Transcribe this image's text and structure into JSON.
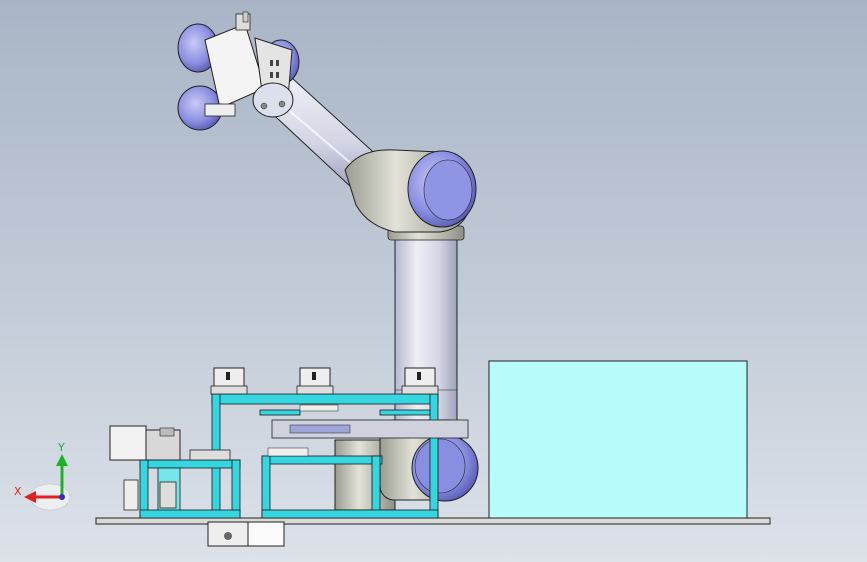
{
  "viewport": {
    "model": "robot-workcell-assembly",
    "colors": {
      "bg_top": "#a9b5c6",
      "bg_bottom": "#dde2e9",
      "arm_body": "#dfe0ec",
      "arm_shade": "#9aa0b8",
      "joint_cap": "#7e82d8",
      "frame": "#35d6e0",
      "cabinet": "#b7fbfb",
      "line": "#1a1a1a"
    }
  },
  "triad": {
    "x_label": "X",
    "y_label": "Y",
    "x_color": "#e0201e",
    "y_color": "#19b526",
    "z_color": "#2a2acd"
  }
}
